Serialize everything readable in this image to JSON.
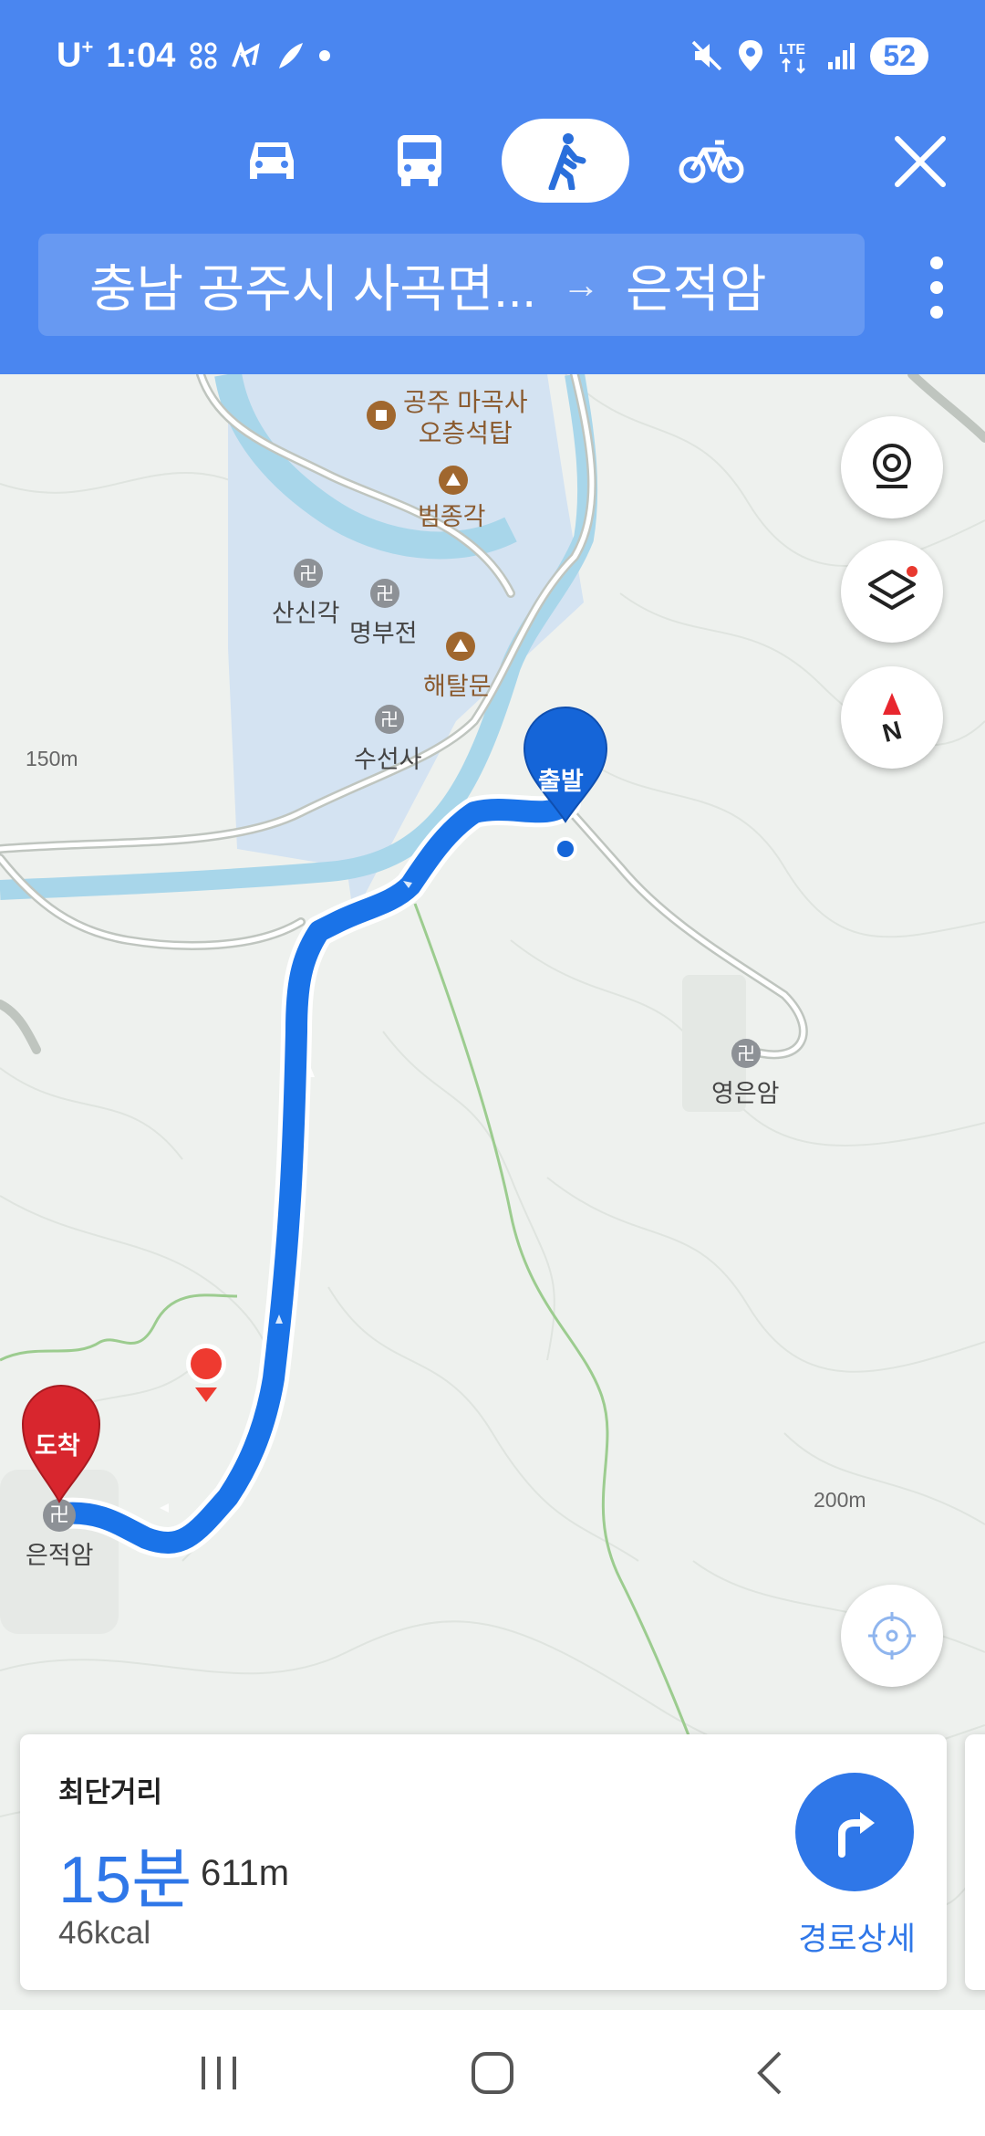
{
  "status_bar": {
    "carrier": "U",
    "carrier_sup": "+",
    "time": "1:04",
    "battery": "52"
  },
  "transport_modes": [
    {
      "name": "car-icon",
      "active": false
    },
    {
      "name": "bus-icon",
      "active": false
    },
    {
      "name": "walk-icon",
      "active": true
    },
    {
      "name": "bicycle-icon",
      "active": false
    }
  ],
  "route": {
    "from": "충남 공주시 사곡면...",
    "arrow": "→",
    "to": "은적암"
  },
  "map": {
    "pois": [
      {
        "label": "공주 마곡사\n오층석탑",
        "type": "landmark"
      },
      {
        "label": "범종각",
        "type": "landmark"
      },
      {
        "label": "산신각",
        "type": "temple"
      },
      {
        "label": "명부전",
        "type": "temple"
      },
      {
        "label": "해탈문",
        "type": "landmark"
      },
      {
        "label": "수선사",
        "type": "temple"
      },
      {
        "label": "영은암",
        "type": "temple"
      },
      {
        "label": "은적암",
        "type": "temple"
      }
    ],
    "elevations": [
      "150m",
      "200m"
    ],
    "start_marker": "출발",
    "end_marker": "도착"
  },
  "route_card": {
    "title": "최단거리",
    "time": "15분",
    "distance": "611m",
    "calories": "46kcal",
    "detail_label": "경로상세"
  },
  "colors": {
    "header": "#4a86f0",
    "route_line": "#1a73e8",
    "start_pin": "#1565d8",
    "end_pin": "#d8262e",
    "accent": "#2f77e8"
  }
}
